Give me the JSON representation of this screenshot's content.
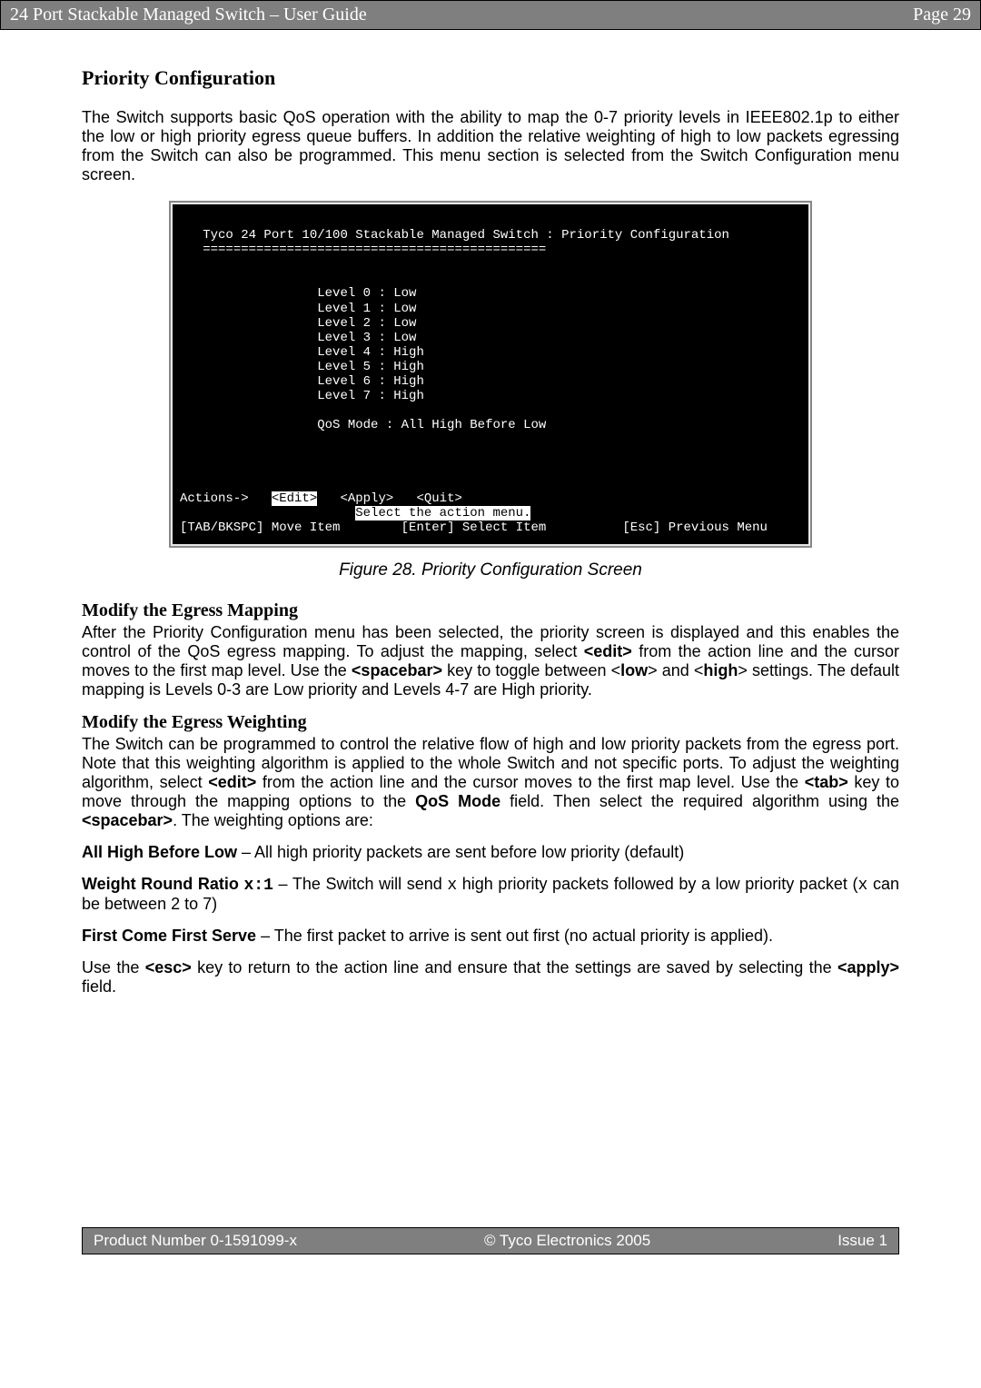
{
  "header": {
    "left": "24 Port Stackable Managed Switch – User Guide",
    "right": "Page 29"
  },
  "section_title": "Priority Configuration",
  "intro_para": "The Switch supports basic QoS operation with the ability to map the 0-7 priority levels in IEEE802.1p to either the low or high priority egress queue buffers. In addition the relative weighting of high to low packets egressing from the Switch can also be programmed. This menu section is selected from the Switch Configuration menu screen.",
  "terminal": {
    "title": "Tyco 24 Port 10/100 Stackable Managed Switch : Priority Configuration",
    "divider": "=============================================",
    "levels": [
      "Level 0 : Low",
      "Level 1 : Low",
      "Level 2 : Low",
      "Level 3 : Low",
      "Level 4 : High",
      "Level 5 : High",
      "Level 6 : High",
      "Level 7 : High"
    ],
    "qos_mode": "QoS Mode : All High Before Low",
    "actions_left": "Actions->   ",
    "actions_edit": "<Edit>",
    "actions_rest": "   <Apply>   <Quit>",
    "hint_pad": "                       ",
    "hint": "Select the action menu.",
    "bottom_left": "[TAB/BKSPC] Move Item",
    "bottom_mid": "[Enter] Select Item",
    "bottom_right": "[Esc] Previous Menu"
  },
  "figure_caption": "Figure 28. Priority Configuration Screen",
  "sub1": {
    "title": "Modify the Egress Mapping",
    "p1a": "After the Priority Configuration menu has been selected, the priority screen is displayed and this enables the control of the QoS egress mapping. To adjust the mapping, select ",
    "edit": "<edit>",
    "p1b": " from the action line and the cursor moves to the first map level. Use the ",
    "spacebar": "<spacebar>",
    "p1c": " key to toggle between <",
    "low": "low",
    "p1d": "> and <",
    "high": "high",
    "p1e": "> settings. The default mapping is Levels 0-3 are Low priority and Levels 4-7 are High priority."
  },
  "sub2": {
    "title": "Modify the Egress Weighting",
    "p1a": "The Switch can be programmed to control the relative flow of high and low priority packets from the egress port. Note that this weighting algorithm is applied to the whole Switch and not specific ports. To adjust the weighting algorithm, select ",
    "edit": "<edit>",
    "p1b": " from the action line and the cursor moves to the first map level. Use the ",
    "tab": "<tab>",
    "p1c": " key to move through the mapping options to the ",
    "qosmode": "QoS Mode",
    "p1d": " field. Then select the required algorithm using the ",
    "spacebar": "<spacebar>",
    "p1e": ". The weighting options are:"
  },
  "opt1": {
    "label": "All High Before Low",
    "rest": " – All high priority packets are sent before low priority (default)"
  },
  "opt2": {
    "label": "Weight Round Ratio ",
    "x1": "x:1",
    "mid": " – The Switch will send ",
    "x": "x",
    "rest1": " high priority packets followed by a low priority packet (",
    "x2": "x",
    "rest2": " can be between 2 to 7)"
  },
  "opt3": {
    "label": "First Come First Serve",
    "rest": " – The first packet to arrive is sent out first (no actual priority is applied)."
  },
  "closing": {
    "a": "Use the ",
    "esc": "<esc>",
    "b": " key to return to the action line and ensure that the settings are saved by selecting the ",
    "apply": "<apply>",
    "c": " field."
  },
  "footer": {
    "left": "Product Number 0-1591099-x",
    "mid": "© Tyco Electronics 2005",
    "right": "Issue 1"
  }
}
